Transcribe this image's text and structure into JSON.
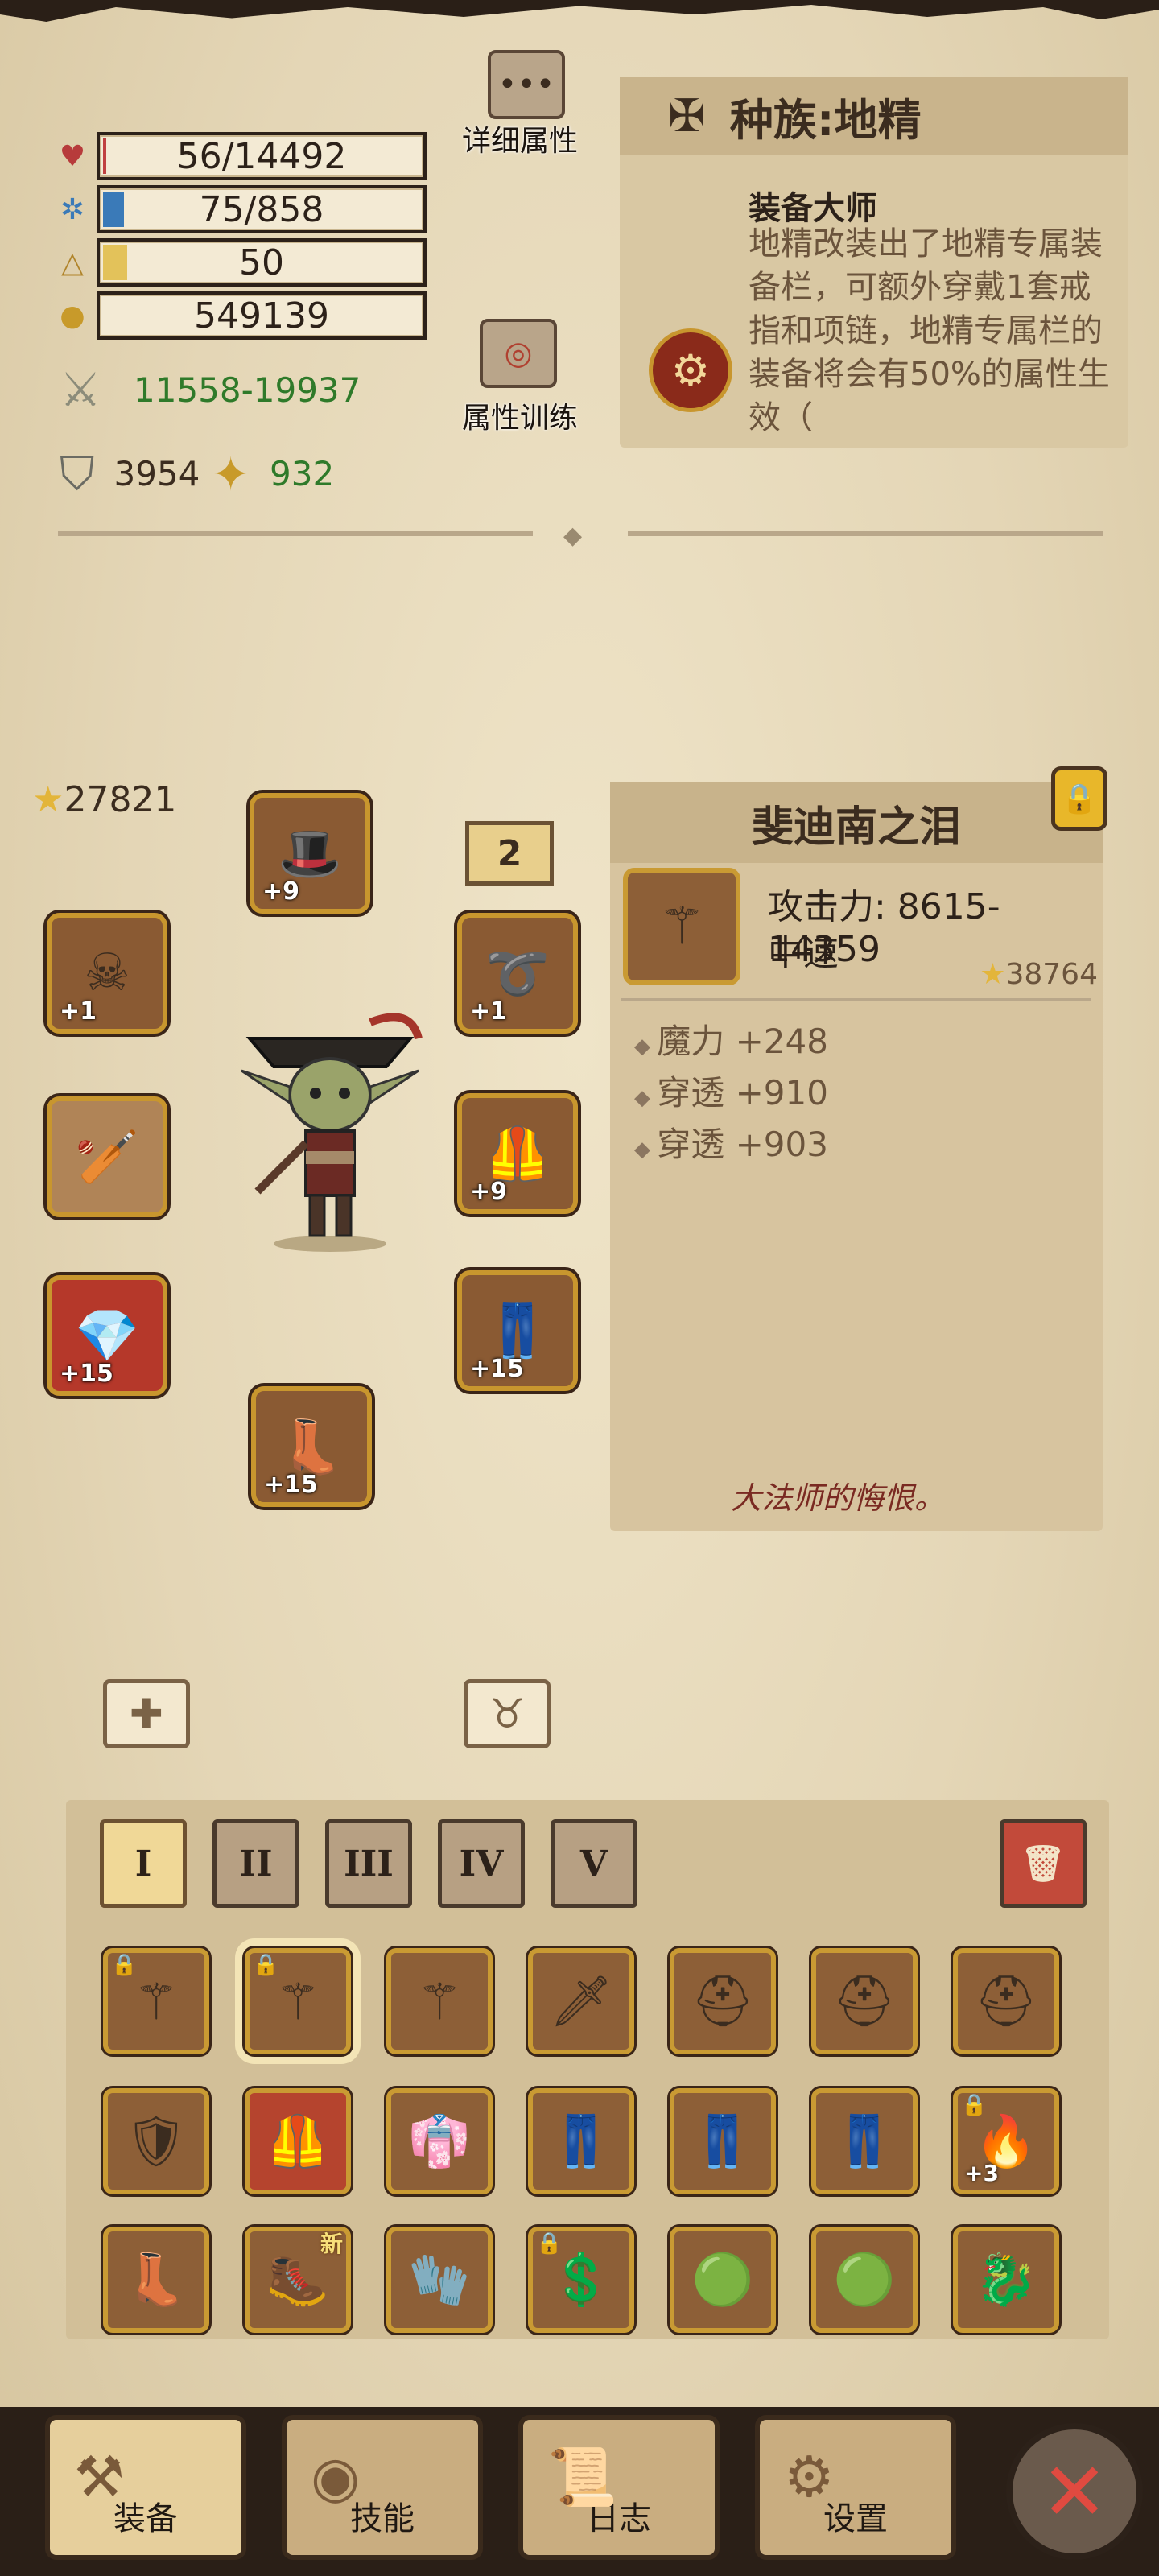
{
  "stats": {
    "hp": "56/14492",
    "mana": "75/858",
    "level": "50",
    "gold": "549139",
    "attack": "11558-19937",
    "armor": "3954",
    "resist": "932"
  },
  "buttons": {
    "detail_attrs": "详细属性",
    "attr_training": "属性训练"
  },
  "race": {
    "title": "种族:地精",
    "skill_title": "装备大师",
    "skill_desc": "地精改装出了地精专属装备栏，可额外穿戴1套戒指和项链，地精专属栏的装备将会有50%的属性生效（"
  },
  "equipment": {
    "power_rating": "27821",
    "set_number": "2",
    "slots": [
      {
        "level": "+9"
      },
      {
        "level": "+1"
      },
      {
        "level": ""
      },
      {
        "level": "+15"
      },
      {
        "level": "+15"
      },
      {
        "level": "+1"
      },
      {
        "level": "+9"
      },
      {
        "level": "+15"
      }
    ]
  },
  "item": {
    "name": "斐迪南之泪",
    "attack": "攻击力: 8615-14359",
    "speed": "中速",
    "rating": "38764",
    "attrs": [
      "魔力 +248",
      "穿透 +910",
      "穿透 +903"
    ],
    "flavor": "大法师的悔恨。"
  },
  "tabs": [
    "I",
    "II",
    "III",
    "IV",
    "V"
  ],
  "inventory": {
    "plus3": "+3",
    "new_tag": "新"
  },
  "nav": {
    "equip": "装备",
    "skills": "技能",
    "log": "日志",
    "settings": "设置"
  },
  "colors": {
    "parchment": "#e8dcc0",
    "gold_border": "#c99a33",
    "green_text": "#2f7a2a",
    "close_red": "#e04a40"
  }
}
